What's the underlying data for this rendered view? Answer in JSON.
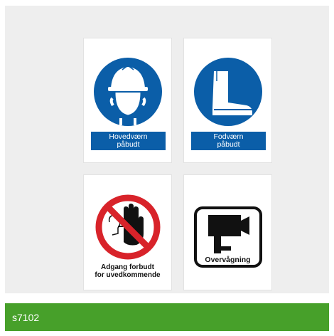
{
  "signs": [
    {
      "icon": "hard-hat-icon",
      "lines": [
        "Hovedværn",
        "påbudt"
      ]
    },
    {
      "icon": "safety-boot-icon",
      "lines": [
        "Fodværn",
        "påbudt"
      ]
    },
    {
      "icon": "no-entry-hand-icon",
      "lines": [
        "Adgang forbudt",
        "for uvedkommende"
      ]
    },
    {
      "icon": "surveillance-camera-icon",
      "lines": [
        "Overvågning"
      ]
    }
  ],
  "footer": {
    "product_code": "s7102"
  },
  "colors": {
    "mandatory_blue": "#0b5ea8",
    "prohibition_red": "#d8232a",
    "footer_green": "#47a02a",
    "panel_grey": "#eeeeee"
  }
}
